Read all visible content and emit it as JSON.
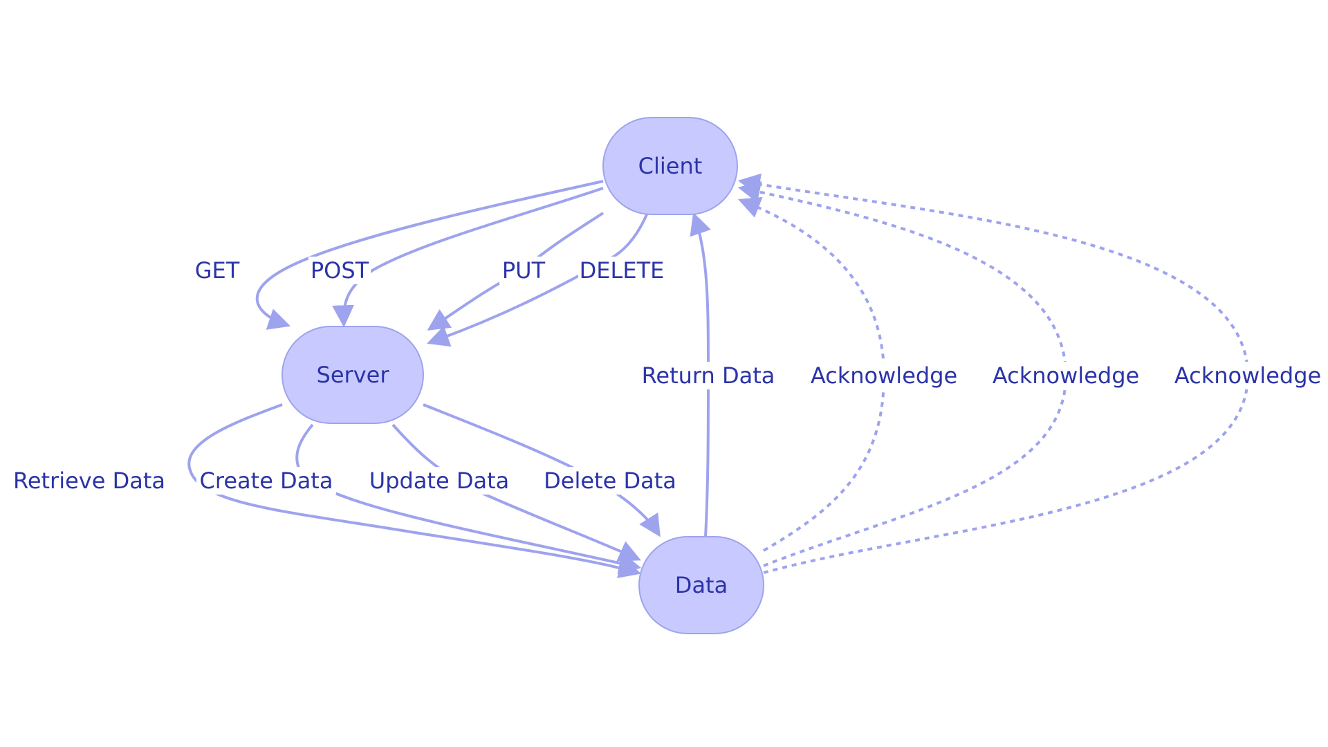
{
  "diagram": {
    "type": "flowchart",
    "colors": {
      "node_fill": "#c8caff",
      "node_stroke": "#9ea3ee",
      "edge": "#9ea3ee",
      "text": "#2b33a8",
      "background": "#ffffff"
    },
    "nodes": [
      {
        "id": "client",
        "label": "Client"
      },
      {
        "id": "server",
        "label": "Server"
      },
      {
        "id": "data",
        "label": "Data"
      }
    ],
    "edges": [
      {
        "id": "get",
        "from": "client",
        "to": "server",
        "label": "GET",
        "style": "solid"
      },
      {
        "id": "post",
        "from": "client",
        "to": "server",
        "label": "POST",
        "style": "solid"
      },
      {
        "id": "put",
        "from": "client",
        "to": "server",
        "label": "PUT",
        "style": "solid"
      },
      {
        "id": "delete",
        "from": "client",
        "to": "server",
        "label": "DELETE",
        "style": "solid"
      },
      {
        "id": "retrieve-data",
        "from": "server",
        "to": "data",
        "label": "Retrieve Data",
        "style": "solid"
      },
      {
        "id": "create-data",
        "from": "server",
        "to": "data",
        "label": "Create Data",
        "style": "solid"
      },
      {
        "id": "update-data",
        "from": "server",
        "to": "data",
        "label": "Update Data",
        "style": "solid"
      },
      {
        "id": "delete-data",
        "from": "server",
        "to": "data",
        "label": "Delete Data",
        "style": "solid"
      },
      {
        "id": "return-data",
        "from": "data",
        "to": "client",
        "label": "Return Data",
        "style": "solid"
      },
      {
        "id": "ack-1",
        "from": "data",
        "to": "client",
        "label": "Acknowledge",
        "style": "dashed"
      },
      {
        "id": "ack-2",
        "from": "data",
        "to": "client",
        "label": "Acknowledge",
        "style": "dashed"
      },
      {
        "id": "ack-3",
        "from": "data",
        "to": "client",
        "label": "Acknowledge",
        "style": "dashed"
      }
    ]
  }
}
